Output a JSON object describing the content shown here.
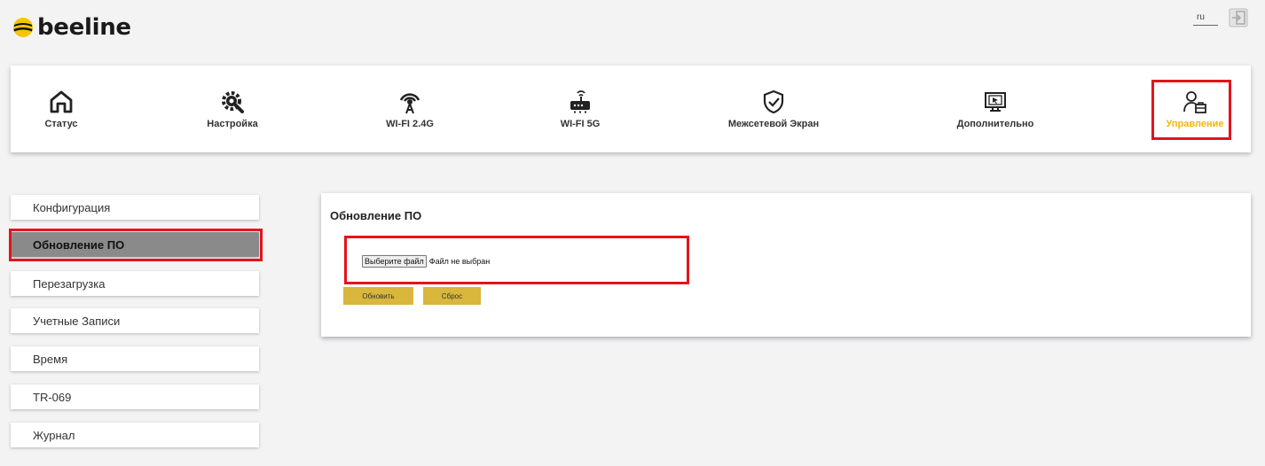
{
  "header": {
    "brand": "beeline",
    "language": "ru",
    "logout_icon": "logout-icon"
  },
  "nav": {
    "items": [
      {
        "label": "Статус",
        "icon": "home-icon"
      },
      {
        "label": "Настройка",
        "icon": "gear-wrench-icon"
      },
      {
        "label": "WI-FI 2.4G",
        "icon": "wifi-antenna-icon"
      },
      {
        "label": "WI-FI 5G",
        "icon": "router-icon"
      },
      {
        "label": "Межсетевой Экран",
        "icon": "shield-check-icon"
      },
      {
        "label": "Дополнительно",
        "icon": "monitor-cursor-icon"
      },
      {
        "label": "Управление",
        "icon": "user-admin-icon",
        "active": true
      }
    ]
  },
  "sidebar": {
    "items": [
      {
        "label": "Конфигурация"
      },
      {
        "label": "Обновление ПО",
        "active": true
      },
      {
        "label": "Перезагрузка"
      },
      {
        "label": "Учетные Записи"
      },
      {
        "label": "Время"
      },
      {
        "label": "TR-069"
      },
      {
        "label": "Журнал"
      }
    ]
  },
  "main": {
    "title": "Обновление ПО",
    "file_button": "Выберите файл",
    "file_status": "Файл не выбран",
    "update_button": "Обновить",
    "reset_button": "Сброс"
  },
  "colors": {
    "accent": "#f2b807",
    "button": "#d9b63c",
    "highlight": "#e3141b",
    "active_sidebar": "#8a8a8a"
  }
}
